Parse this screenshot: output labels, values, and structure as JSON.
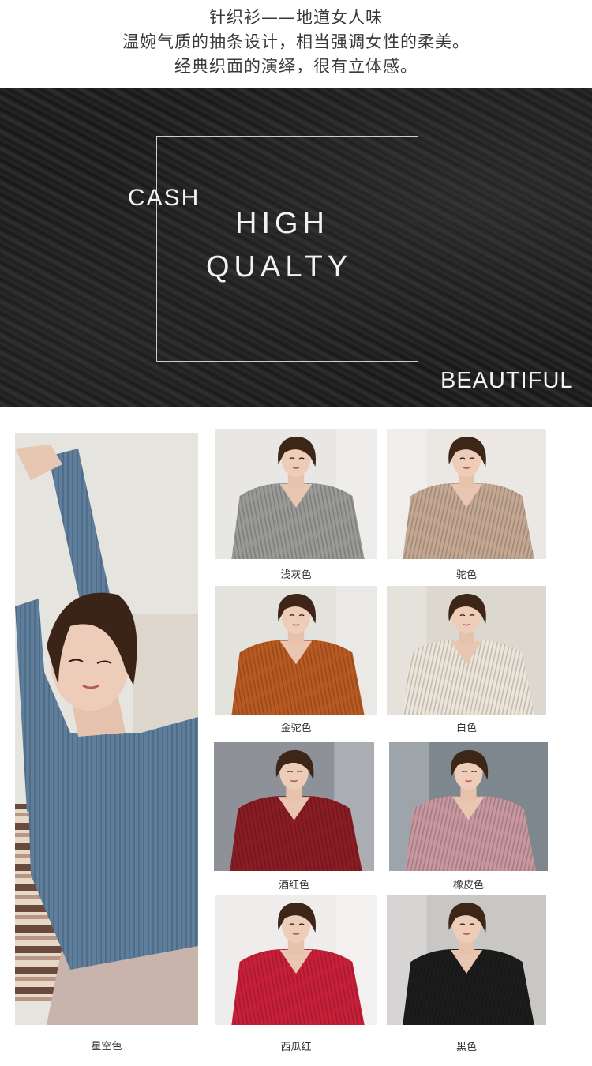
{
  "intro": {
    "line1": "针织衫——地道女人味",
    "line2": "温婉气质的抽条设计，相当强调女性的柔美。",
    "line3": "经典织面的演绎，很有立体感。"
  },
  "banner": {
    "cash": "CASH",
    "high": "HIGH",
    "quality": "QUALTY",
    "beautiful": "BEAUTIFUL"
  },
  "colors": {
    "featured": {
      "label": "星空色",
      "swatch": "#5e7e9c"
    },
    "items": [
      {
        "label": "浅灰色",
        "swatch": "#9a9a98",
        "bg": "#e9e7e4"
      },
      {
        "label": "驼色",
        "swatch": "#c4a894",
        "bg": "#ebe8e3"
      },
      {
        "label": "金驼色",
        "swatch": "#b95a22",
        "bg": "#e4e2dd"
      },
      {
        "label": "白色",
        "swatch": "#ece5da",
        "bg": "#dcd8cf"
      },
      {
        "label": "酒红色",
        "swatch": "#8a1c24",
        "bg": "#8e9298"
      },
      {
        "label": "橡皮色",
        "swatch": "#c897a0",
        "bg": "#7e878e"
      },
      {
        "label": "西瓜红",
        "swatch": "#c9203a",
        "bg": "#eeedeb"
      },
      {
        "label": "黑色",
        "swatch": "#1c1c1c",
        "bg": "#c9c7c4"
      }
    ]
  }
}
